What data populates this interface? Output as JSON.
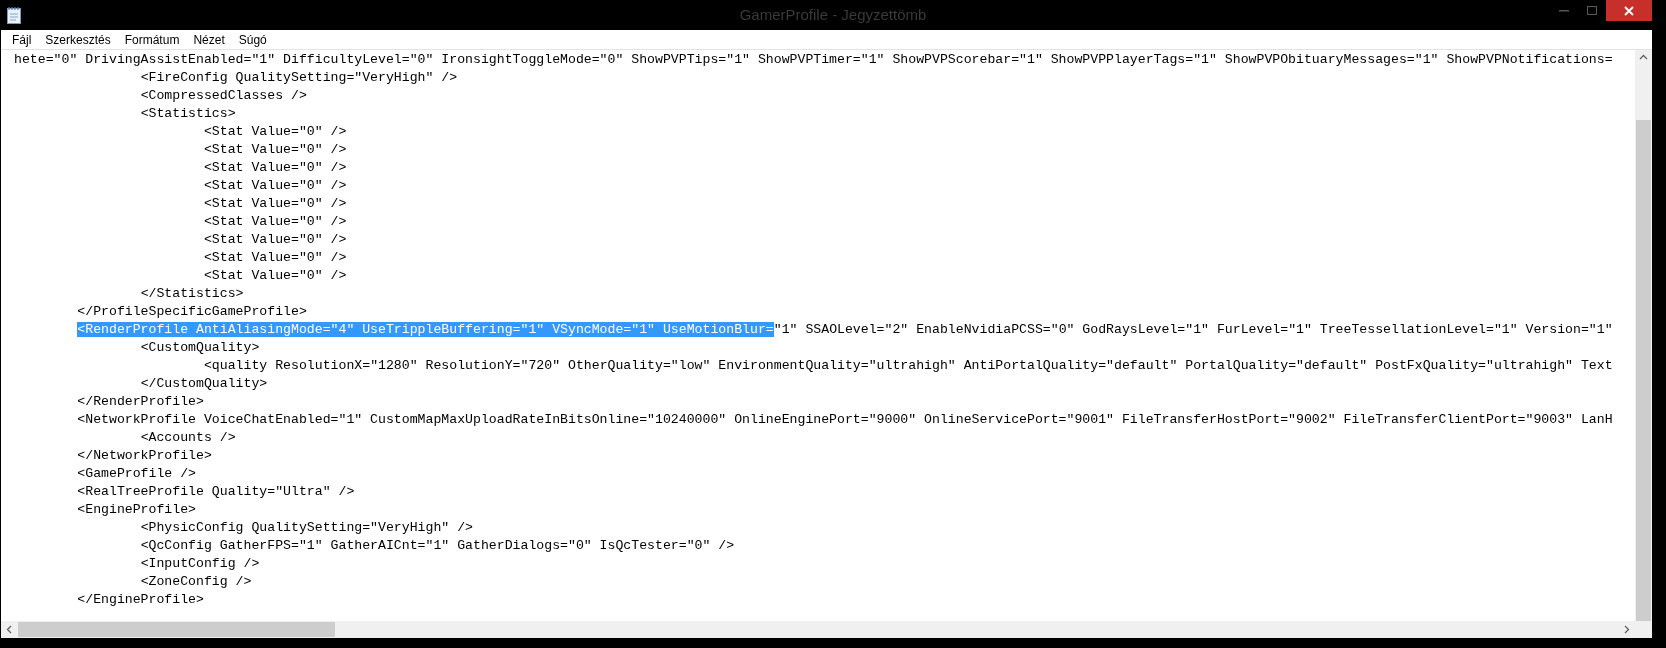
{
  "window": {
    "title": "GamerProfile - Jegyzettömb"
  },
  "menu": [
    "Fájl",
    "Szerkesztés",
    "Formátum",
    "Nézet",
    "Súgó"
  ],
  "lines": [
    {
      "text": "hete=\"0\" DrivingAssistEnabled=\"1\" DifficultyLevel=\"0\" IronsightToggleMode=\"0\" ShowPVPTips=\"1\" ShowPVPTimer=\"1\" ShowPVPScorebar=\"1\" ShowPVPPlayerTags=\"1\" ShowPVPObituaryMessages=\"1\" ShowPVPNotifications="
    },
    {
      "text": "\t\t<FireConfig QualitySetting=\"VeryHigh\" />"
    },
    {
      "text": "\t\t<CompressedClasses />"
    },
    {
      "text": "\t\t<Statistics>"
    },
    {
      "text": "\t\t\t<Stat Value=\"0\" />"
    },
    {
      "text": "\t\t\t<Stat Value=\"0\" />"
    },
    {
      "text": "\t\t\t<Stat Value=\"0\" />"
    },
    {
      "text": "\t\t\t<Stat Value=\"0\" />"
    },
    {
      "text": "\t\t\t<Stat Value=\"0\" />"
    },
    {
      "text": "\t\t\t<Stat Value=\"0\" />"
    },
    {
      "text": "\t\t\t<Stat Value=\"0\" />"
    },
    {
      "text": "\t\t\t<Stat Value=\"0\" />"
    },
    {
      "text": "\t\t\t<Stat Value=\"0\" />"
    },
    {
      "text": "\t\t</Statistics>"
    },
    {
      "text": "\t</ProfileSpecificGameProfile>"
    },
    {
      "selected_text": "\t<RenderProfile AntiAliasingMode=\"4\" UseTrippleBuffering=\"1\" VSyncMode=\"1\" UseMotionBlur=",
      "text": "\"1\" SSAOLevel=\"2\" EnableNvidiaPCSS=\"0\" GodRaysLevel=\"1\" FurLevel=\"1\" TreeTessellationLevel=\"1\" Version=\"1\""
    },
    {
      "text": "\t\t<CustomQuality>"
    },
    {
      "text": "\t\t\t<quality ResolutionX=\"1280\" ResolutionY=\"720\" OtherQuality=\"low\" EnvironmentQuality=\"ultrahigh\" AntiPortalQuality=\"default\" PortalQuality=\"default\" PostFxQuality=\"ultrahigh\" Text"
    },
    {
      "text": "\t\t</CustomQuality>"
    },
    {
      "text": "\t</RenderProfile>"
    },
    {
      "text": "\t<NetworkProfile VoiceChatEnabled=\"1\" CustomMapMaxUploadRateInBitsOnline=\"10240000\" OnlineEnginePort=\"9000\" OnlineServicePort=\"9001\" FileTransferHostPort=\"9002\" FileTransferClientPort=\"9003\" LanH"
    },
    {
      "text": "\t\t<Accounts />"
    },
    {
      "text": "\t</NetworkProfile>"
    },
    {
      "text": "\t<GameProfile />"
    },
    {
      "text": "\t<RealTreeProfile Quality=\"Ultra\" />"
    },
    {
      "text": "\t<EngineProfile>"
    },
    {
      "text": "\t\t<PhysicConfig QualitySetting=\"VeryHigh\" />"
    },
    {
      "text": "\t\t<QcConfig GatherFPS=\"1\" GatherAICnt=\"1\" GatherDialogs=\"0\" IsQcTester=\"0\" />"
    },
    {
      "text": "\t\t<InputConfig />"
    },
    {
      "text": "\t\t<ZoneConfig />"
    },
    {
      "text": "\t</EngineProfile>"
    }
  ]
}
